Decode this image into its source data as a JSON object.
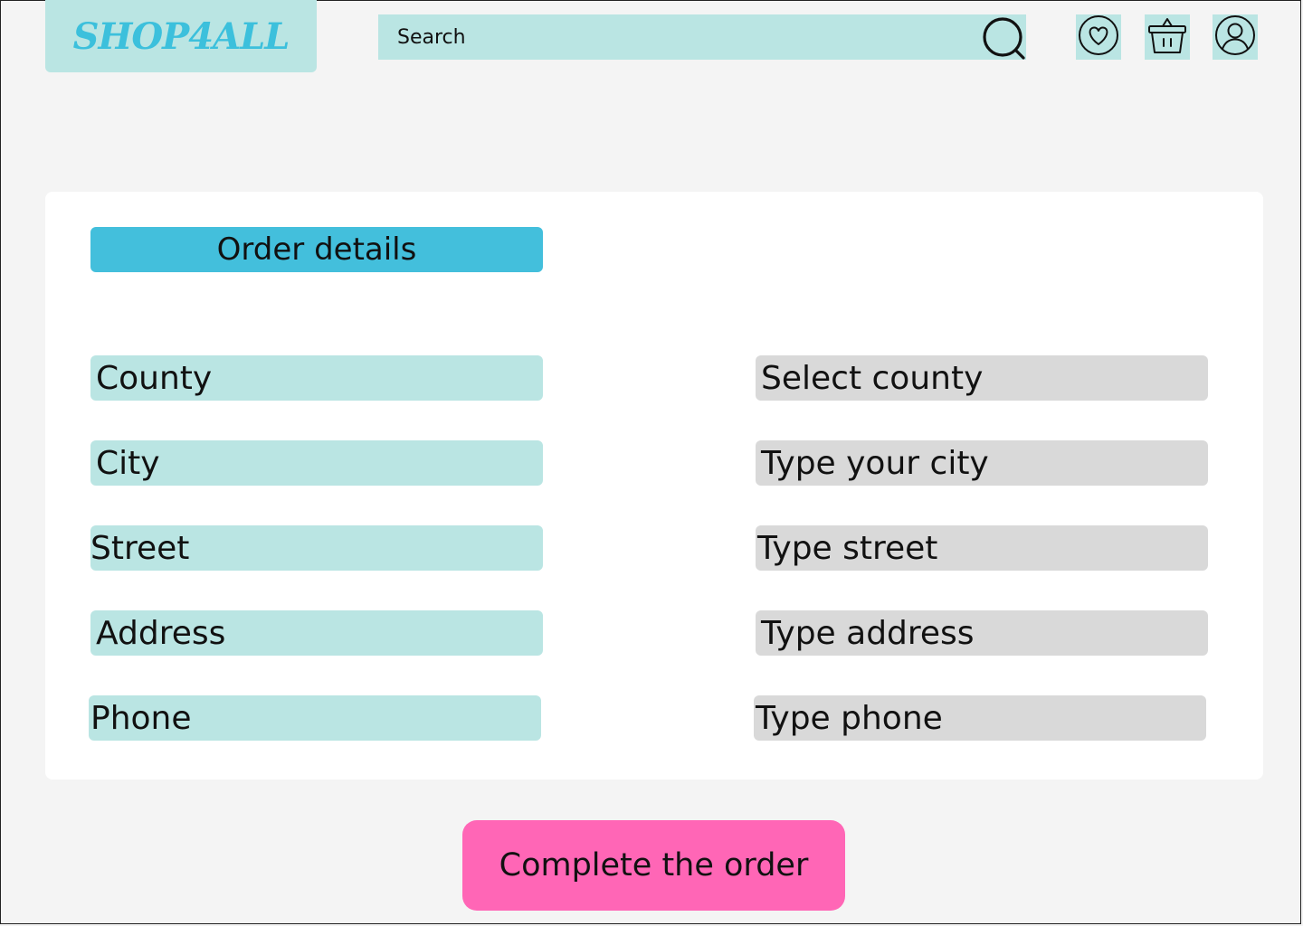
{
  "header": {
    "logo_text": "SHOP4ALL",
    "search": {
      "placeholder": "Search"
    },
    "icons": [
      "search-icon",
      "heart-icon",
      "basket-icon",
      "user-icon"
    ]
  },
  "order_form": {
    "title": "Order details",
    "fields": [
      {
        "label": "County",
        "input_text": "Select county"
      },
      {
        "label": "City",
        "input_text": "Type your city"
      },
      {
        "label": "Street",
        "input_text": "Type street"
      },
      {
        "label": "Address",
        "input_text": "Type address"
      },
      {
        "label": "Phone",
        "input_text": "Type phone"
      }
    ]
  },
  "complete_button": {
    "label": "Complete the order"
  },
  "colors": {
    "background": "#f4f4f4",
    "teal_light": "#bae5e3",
    "title_blue": "#43bfdc",
    "logo_blue": "#3cc0dc",
    "input_gray": "#d9d9d9",
    "button_pink": "#ff66b6"
  }
}
